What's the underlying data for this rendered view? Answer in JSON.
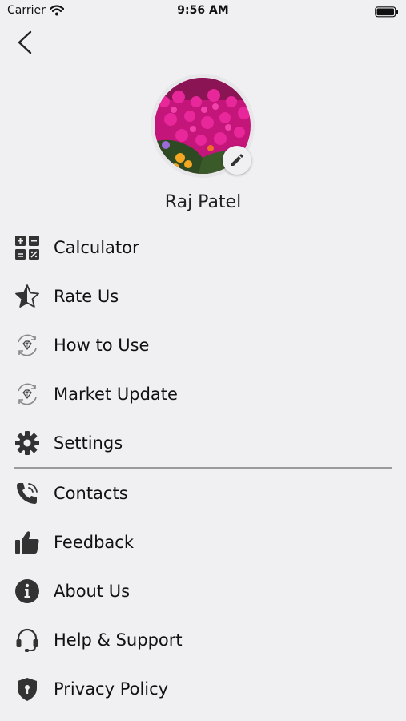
{
  "status_bar": {
    "carrier": "Carrier",
    "time": "9:56 AM"
  },
  "profile": {
    "name": "Raj Patel"
  },
  "menu_primary": [
    {
      "label": "Calculator",
      "icon": "calculator-icon"
    },
    {
      "label": "Rate Us",
      "icon": "star-half-icon"
    },
    {
      "label": "How to Use",
      "icon": "diamond-refresh-icon"
    },
    {
      "label": "Market Update",
      "icon": "diamond-refresh-icon"
    },
    {
      "label": "Settings",
      "icon": "gear-icon"
    }
  ],
  "menu_secondary": [
    {
      "label": "Contacts",
      "icon": "phone-icon"
    },
    {
      "label": "Feedback",
      "icon": "thumbs-up-icon"
    },
    {
      "label": "About Us",
      "icon": "info-icon"
    },
    {
      "label": "Help & Support",
      "icon": "headset-icon"
    },
    {
      "label": "Privacy Policy",
      "icon": "shield-lock-icon"
    }
  ]
}
